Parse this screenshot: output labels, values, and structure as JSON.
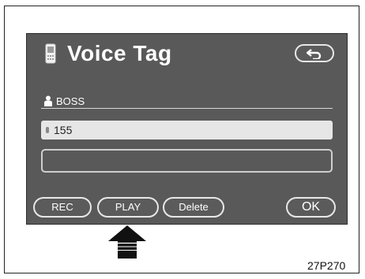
{
  "screen": {
    "title": "Voice Tag",
    "contact_name": "BOSS",
    "entries": [
      {
        "value": "155"
      },
      {
        "value": ""
      }
    ],
    "buttons": {
      "rec": "REC",
      "play": "PLAY",
      "delete": "Delete",
      "ok": "OK"
    },
    "icons": {
      "title_icon": "phone-icon",
      "back": "back-arrow-icon",
      "contact": "person-icon",
      "pointer": "up-arrow-icon"
    }
  },
  "figure_caption": "27P270"
}
